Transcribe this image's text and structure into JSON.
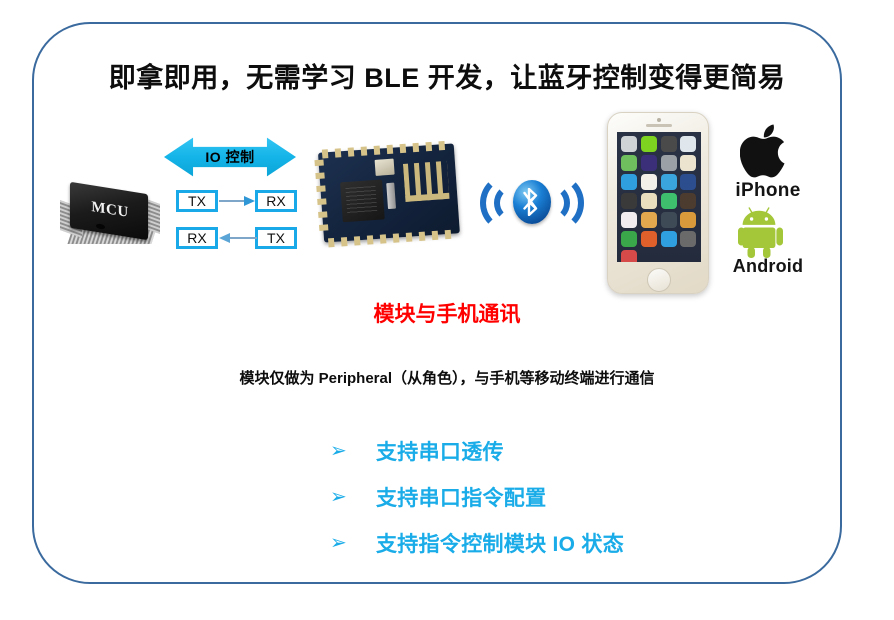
{
  "slide": {
    "title": "即拿即用，无需学习 BLE 开发，让蓝牙控制变得更简易",
    "red_subtitle": "模块与手机通讯",
    "description": "模块仅做为 Peripheral（从角色），与手机等移动终端进行通信",
    "frame_border_color": "#3a6a9e"
  },
  "diagram": {
    "mcu": {
      "label": "MCU",
      "icon": "mcu-chip-icon"
    },
    "io_arrow": {
      "label": "IO 控制",
      "color": "#14b4e8",
      "icon": "double-arrow-icon"
    },
    "uart": {
      "box_border_color": "#19a9e8",
      "top_row": {
        "left": "TX",
        "right": "RX",
        "direction": "right"
      },
      "bottom_row": {
        "left": "RX",
        "right": "TX",
        "direction": "left"
      }
    },
    "ble_module": {
      "icon": "ble-module-board-icon",
      "pcb_color": "#14253f",
      "pad_color": "#d6c389"
    },
    "bluetooth": {
      "icon": "bluetooth-signal-icon",
      "color": "#1f6fc4"
    },
    "phone": {
      "icon": "iphone-device-icon",
      "app_colors": [
        "#cfd3d6",
        "#7ed321",
        "#4a4a4a",
        "#dfe6ec",
        "#6fbf5f",
        "#3b2f7a",
        "#9aa0a6",
        "#ece4cf",
        "#2f9fe0",
        "#f3f0ea",
        "#39a5dc",
        "#2c4d8e",
        "#3a3a3a",
        "#e9dfbe",
        "#3dbf6e",
        "#4c3b2f",
        "#f0ecef",
        "#e3a84e",
        "#3f4a57",
        "#d99a3c",
        "#3aa84a",
        "#e0602c",
        "#2f9fe0",
        "#6a6a6a",
        "#d64a4a"
      ]
    },
    "apple": {
      "icon": "apple-logo-icon",
      "label": "iPhone",
      "color": "#141414"
    },
    "android": {
      "icon": "android-robot-icon",
      "label": "Android",
      "color": "#A4C639"
    }
  },
  "features": {
    "bullet_glyph": "➢",
    "accent_color": "#19ace8",
    "items": [
      {
        "text": "支持串口透传"
      },
      {
        "text": "支持串口指令配置"
      },
      {
        "text": "支持指令控制模块 IO 状态"
      }
    ]
  }
}
